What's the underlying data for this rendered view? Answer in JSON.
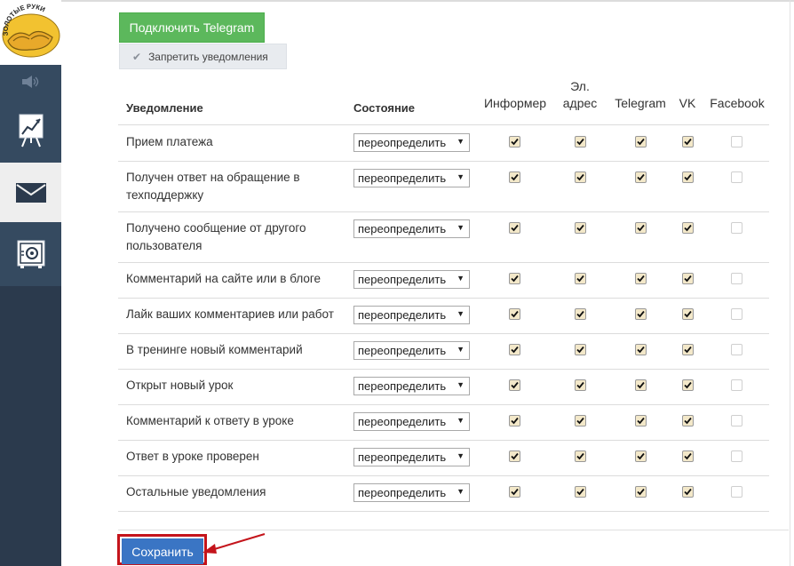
{
  "sidebar": {
    "logo_text": "ЗОЛОТЫЕ РУКИ",
    "items": [
      {
        "icon": "speaker-icon"
      },
      {
        "icon": "stats-chart-icon"
      },
      {
        "icon": "envelope-icon"
      },
      {
        "icon": "safe-icon"
      }
    ]
  },
  "actions": {
    "telegram_button": "Подключить Telegram",
    "forbid_button": "Запретить уведомления",
    "save_button": "Сохранить"
  },
  "table": {
    "headers": {
      "notification": "Уведомление",
      "state": "Состояние",
      "informer": "Информер",
      "email_line1": "Эл.",
      "email_line2": "адрес",
      "telegram": "Telegram",
      "vk": "VK",
      "facebook": "Facebook"
    },
    "rows": [
      {
        "name": "Прием платежа",
        "state": "переопределить",
        "informer": true,
        "email": true,
        "telegram": true,
        "vk": true,
        "facebook": false
      },
      {
        "name": "Получен ответ на обращение в техподдержку",
        "state": "переопределить",
        "informer": true,
        "email": true,
        "telegram": true,
        "vk": true,
        "facebook": false
      },
      {
        "name": "Получено сообщение от другого пользователя",
        "state": "переопределить",
        "informer": true,
        "email": true,
        "telegram": true,
        "vk": true,
        "facebook": false
      },
      {
        "name": "Комментарий на сайте или в блоге",
        "state": "переопределить",
        "informer": true,
        "email": true,
        "telegram": true,
        "vk": true,
        "facebook": false
      },
      {
        "name": "Лайк ваших комментариев или работ",
        "state": "переопределить",
        "informer": true,
        "email": true,
        "telegram": true,
        "vk": true,
        "facebook": false
      },
      {
        "name": "В тренинге новый комментарий",
        "state": "переопределить",
        "informer": true,
        "email": true,
        "telegram": true,
        "vk": true,
        "facebook": false
      },
      {
        "name": "Открыт новый урок",
        "state": "переопределить",
        "informer": true,
        "email": true,
        "telegram": true,
        "vk": true,
        "facebook": false
      },
      {
        "name": "Комментарий к ответу в уроке",
        "state": "переопределить",
        "informer": true,
        "email": true,
        "telegram": true,
        "vk": true,
        "facebook": false
      },
      {
        "name": "Ответ в уроке проверен",
        "state": "переопределить",
        "informer": true,
        "email": true,
        "telegram": true,
        "vk": true,
        "facebook": false
      },
      {
        "name": "Остальные уведомления",
        "state": "переопределить",
        "informer": true,
        "email": true,
        "telegram": true,
        "vk": true,
        "facebook": false
      }
    ]
  },
  "colors": {
    "sidebar": "#2b3a4d",
    "telegram_button": "#5cb85c",
    "save_button": "#3a75c4",
    "annotation": "#c4141b"
  }
}
